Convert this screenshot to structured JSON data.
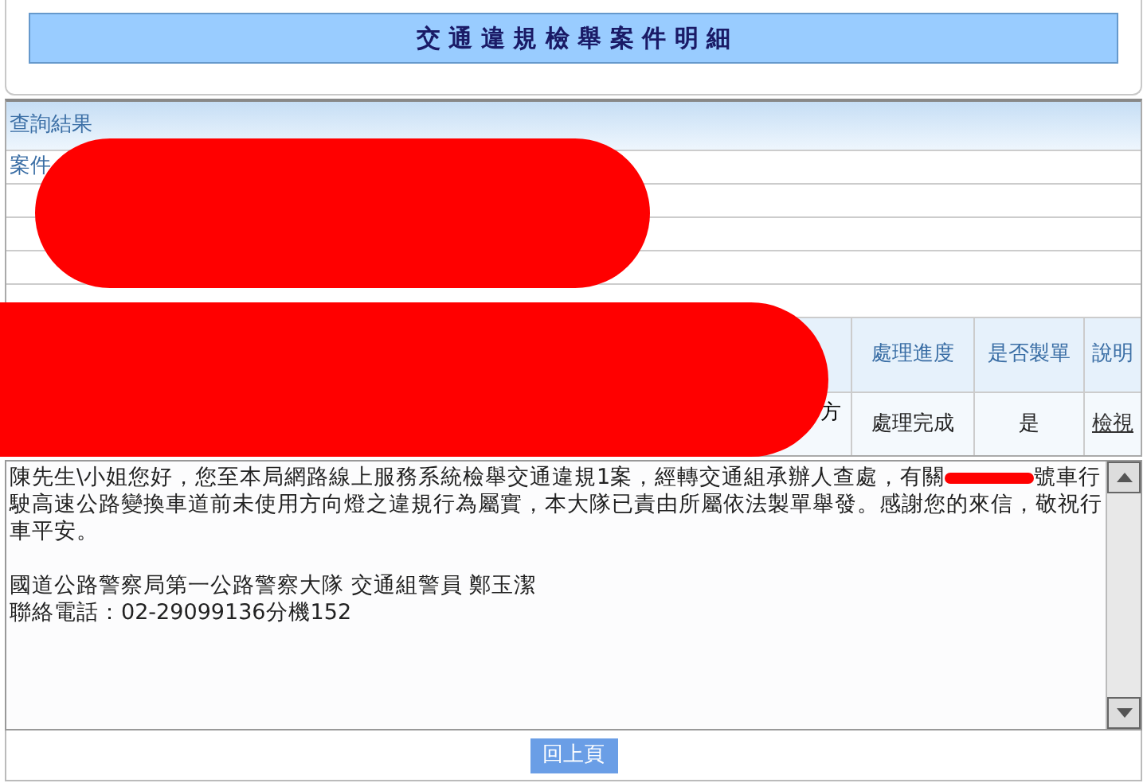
{
  "title": "交 通 違 規 檢 舉 案 件 明 細",
  "results": {
    "header": "查詢結果",
    "fields": [
      {
        "label": "案件"
      }
    ]
  },
  "table": {
    "columns": [
      "處理進度",
      "是否製單",
      "說明"
    ],
    "row": {
      "column_1": "方",
      "cells": [
        {
          "text": "處理完成",
          "kind": "text"
        },
        {
          "text": "是",
          "kind": "text"
        },
        {
          "text": "檢視",
          "kind": "link"
        }
      ]
    }
  },
  "message": {
    "before": "陳先生\\小姐您好，您至本局網路線上服務系統檢舉交通違規1案，經轉交通組承辦人查處，有關",
    "after": "號車行駛高速公路變換車道前未使用方向燈之違規行為屬實，本大隊已責由所屬依法製單舉發。感謝您的來信，敬祝行車平安。",
    "lines": [
      "國道公路警察局第一公路警察大隊 交通組警員 鄭玉潔",
      "聯絡電話：02-29099136分機152"
    ]
  },
  "back_button": "回上頁"
}
